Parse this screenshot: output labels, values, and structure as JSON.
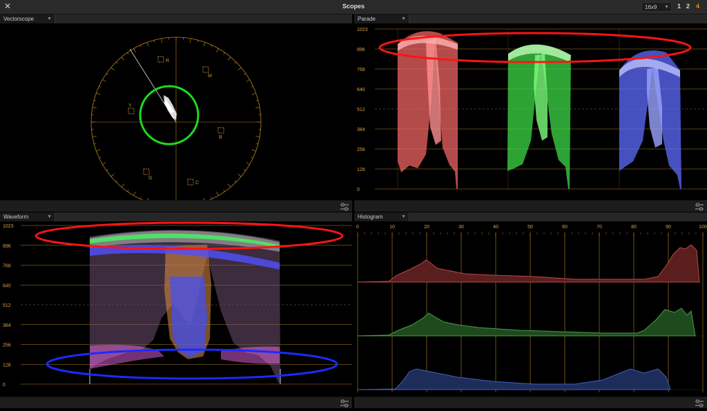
{
  "window": {
    "title": "Scopes",
    "close_glyph": "✕",
    "aspect": {
      "value": "16x9"
    },
    "layouts": [
      {
        "label": "1",
        "active": false
      },
      {
        "label": "2",
        "active": false
      },
      {
        "label": "4",
        "active": true
      }
    ]
  },
  "colors": {
    "accent": "#e38a1f",
    "graticule": "#b8861f",
    "annotation_red": "#ff1414",
    "annotation_green": "#1cdc1c",
    "annotation_blue": "#1a2bff"
  },
  "panels": {
    "vectorscope": {
      "title": "Vectorscope",
      "targets": [
        "R",
        "M",
        "B",
        "C",
        "G",
        "Y"
      ]
    },
    "parade": {
      "title": "Parade",
      "y_ticks": [
        "1023",
        "896",
        "768",
        "640",
        "512",
        "384",
        "256",
        "128",
        "0"
      ]
    },
    "waveform": {
      "title": "Waveform",
      "y_ticks": [
        "1023",
        "896",
        "768",
        "640",
        "512",
        "384",
        "256",
        "128",
        "0"
      ]
    },
    "histogram": {
      "title": "Histogram",
      "x_ticks": [
        "0",
        "10",
        "20",
        "30",
        "40",
        "50",
        "60",
        "70",
        "80",
        "90",
        "100"
      ]
    }
  },
  "icons": {
    "close": "close-icon",
    "chevron": "chevron-down-icon",
    "settings": "sliders-icon"
  }
}
